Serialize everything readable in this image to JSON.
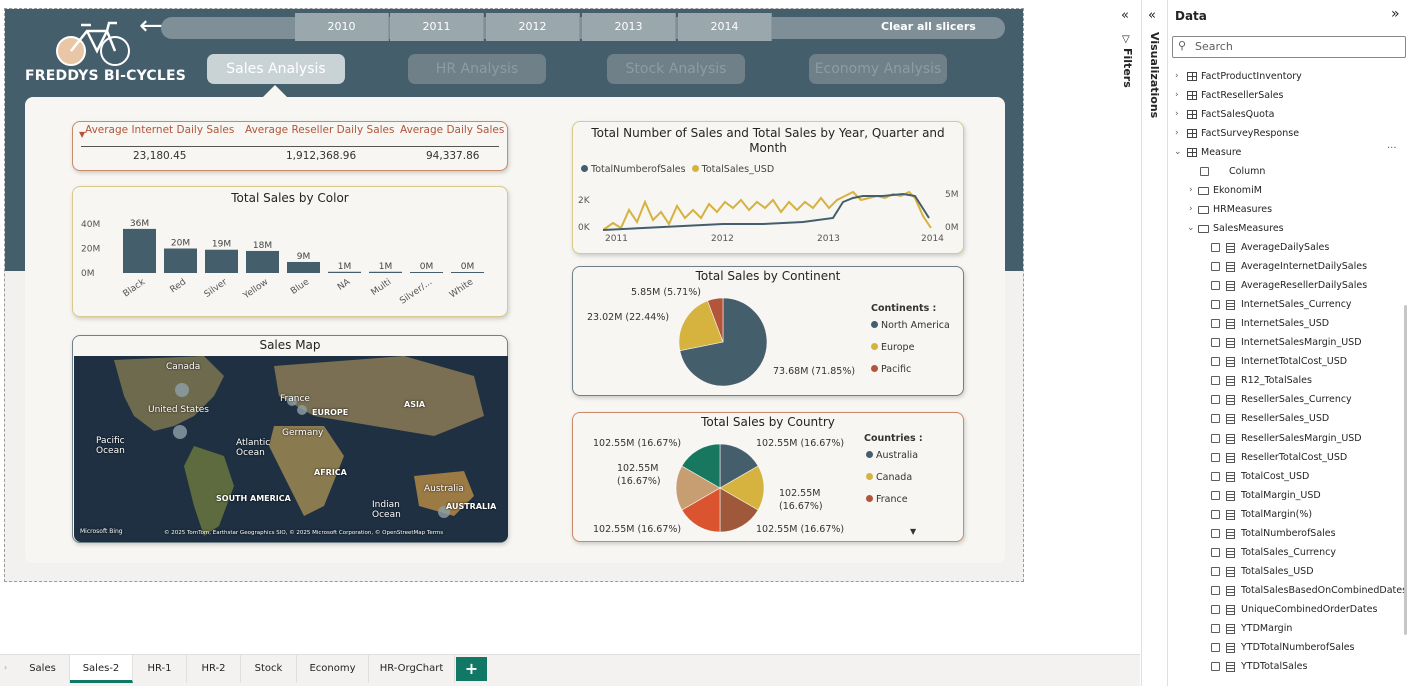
{
  "app": {
    "logo_text": "FREDDYS BI-CYCLES"
  },
  "slicer": {
    "years": [
      "2010",
      "2011",
      "2012",
      "2013",
      "2014"
    ],
    "clear_label": "Clear all slicers"
  },
  "nav": {
    "buttons": [
      "Sales Analysis",
      "HR Analysis",
      "Stock Analysis",
      "Economy Analysis"
    ],
    "active": "Sales Analysis"
  },
  "kpi": {
    "labels": [
      "Average Internet Daily Sales",
      "Average Reseller Daily Sales",
      "Average Daily Sales"
    ],
    "values": [
      "23,180.45",
      "1,912,368.96",
      "94,337.86"
    ]
  },
  "color_chart": {
    "chart_data": {
      "type": "bar",
      "title": "Total Sales by Color",
      "categories": [
        "Black",
        "Red",
        "Silver",
        "Yellow",
        "Blue",
        "NA",
        "Multi",
        "Silver/...",
        "White"
      ],
      "values": [
        36,
        20,
        19,
        18,
        9,
        1,
        1,
        0,
        0
      ],
      "data_labels": [
        "36M",
        "20M",
        "19M",
        "18M",
        "9M",
        "1M",
        "1M",
        "0M",
        "0M"
      ],
      "y_ticks": [
        "40M",
        "20M",
        "0M"
      ],
      "ylim": [
        0,
        40
      ],
      "color": "#455e6b"
    }
  },
  "line_chart": {
    "chart_data": {
      "type": "line",
      "title": "Total Number of Sales and Total Sales by Year, Quarter and Month",
      "series": [
        {
          "name": "TotalNumberofSales",
          "color": "#455e6b"
        },
        {
          "name": "TotalSales_USD",
          "color": "#d6b23e"
        }
      ],
      "x_ticks": [
        "2011",
        "2012",
        "2013",
        "2014"
      ],
      "y_left_ticks": [
        "2K",
        "0K"
      ],
      "y_right_ticks": [
        "5M",
        "0M"
      ]
    }
  },
  "map": {
    "title": "Sales Map",
    "labels": [
      "Canada",
      "United States",
      "France",
      "Germany",
      "EUROPE",
      "ASIA",
      "AFRICA",
      "SOUTH AMERICA",
      "Australia",
      "AUSTRALIA",
      "Pacific Ocean",
      "Atlantic Ocean",
      "Indian Ocean"
    ],
    "attribution": "© 2025 TomTom, Earthstar Geographics SIO, © 2025 Microsoft Corporation, © OpenStreetMap  Terms",
    "bing": "Microsoft Bing"
  },
  "continent_chart": {
    "chart_data": {
      "type": "pie",
      "title": "Total Sales by Continent",
      "legend_title": "Continents :",
      "categories": [
        "North America",
        "Europe",
        "Pacific"
      ],
      "values": [
        73.68,
        23.02,
        5.85
      ],
      "labels": [
        "73.68M (71.85%)",
        "23.02M (22.44%)",
        "5.85M (5.71%)"
      ],
      "colors": [
        "#455e6b",
        "#d6b23e",
        "#b2553a"
      ]
    }
  },
  "country_chart": {
    "chart_data": {
      "type": "pie",
      "title": "Total Sales by Country",
      "legend_title": "Countries :",
      "categories": [
        "Australia",
        "Canada",
        "France"
      ],
      "values": [
        102.55,
        102.55,
        102.55,
        102.55,
        102.55,
        102.55
      ],
      "labels": [
        "102.55M (16.67%)",
        "102.55M (16.67%)",
        "102.55M",
        "(16.67%)",
        "102.55M (16.67%)",
        "102.55M (16.67%)",
        "102.55M",
        "(16.67%)"
      ],
      "colors": [
        "#455e6b",
        "#d6b23e",
        "#a0583a",
        "#d9542f",
        "#c79e72",
        "#17775f"
      ]
    }
  },
  "panes": {
    "filters": "Filters",
    "visualizations": "Visualizations",
    "data_title": "Data",
    "search_placeholder": "Search",
    "tables": [
      "FactProductInventory",
      "FactResellerSales",
      "FactSalesQuota",
      "FactSurveyResponse"
    ],
    "measure": "Measure",
    "column": "Column",
    "folders": [
      "EkonomiM",
      "HRMeasures",
      "SalesMeasures"
    ],
    "measures": [
      "AverageDailySales",
      "AverageInternetDailySales",
      "AverageResellerDailySales",
      "InternetSales_Currency",
      "InternetSales_USD",
      "InternetSalesMargin_USD",
      "InternetTotalCost_USD",
      "R12_TotalSales",
      "ResellerSales_Currency",
      "ResellerSales_USD",
      "ResellerSalesMargin_USD",
      "ResellerTotalCost_USD",
      "TotalCost_USD",
      "TotalMargin_USD",
      "TotalMargin(%)",
      "TotalNumberofSales",
      "TotalSales_Currency",
      "TotalSales_USD",
      "TotalSalesBasedOnCombinedDates",
      "UniqueCombinedOrderDates",
      "YTDMargin",
      "YTDTotalNumberofSales",
      "YTDTotalSales"
    ]
  },
  "tabs": {
    "pages": [
      "Sales",
      "Sales-2",
      "HR-1",
      "HR-2",
      "Stock",
      "Economy",
      "HR-OrgChart"
    ],
    "active": "Sales-2",
    "add": "+"
  }
}
